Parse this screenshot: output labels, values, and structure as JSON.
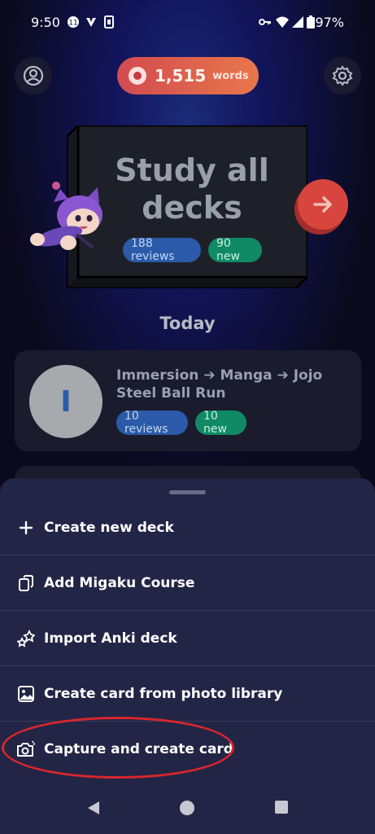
{
  "status_bar": {
    "time": "9:50",
    "battery": "97%"
  },
  "header": {
    "words_count": "1,515",
    "words_unit": "words"
  },
  "study": {
    "title_line1": "Study all",
    "title_line2": "decks",
    "reviews": "188 reviews",
    "new": "90 new"
  },
  "today": {
    "title": "Today",
    "deck": {
      "initial": "I",
      "name": "Immersion ➔ Manga ➔ Jojo Steel Ball Run",
      "reviews": "10 reviews",
      "new": "10 new"
    }
  },
  "menu": {
    "items": [
      {
        "label": "Create new deck",
        "icon": "plus-icon"
      },
      {
        "label": "Add Migaku Course",
        "icon": "cards-icon"
      },
      {
        "label": "Import Anki deck",
        "icon": "anki-icon"
      },
      {
        "label": "Create card from photo library",
        "icon": "image-icon"
      },
      {
        "label": "Capture and create card",
        "icon": "camera-icon"
      }
    ]
  },
  "colors": {
    "accent_red": "#d8453e",
    "sheet_bg": "#222545",
    "badge_blue": "#2a5aa8",
    "badge_green": "#108a64",
    "annotation_red": "#d8262d"
  }
}
